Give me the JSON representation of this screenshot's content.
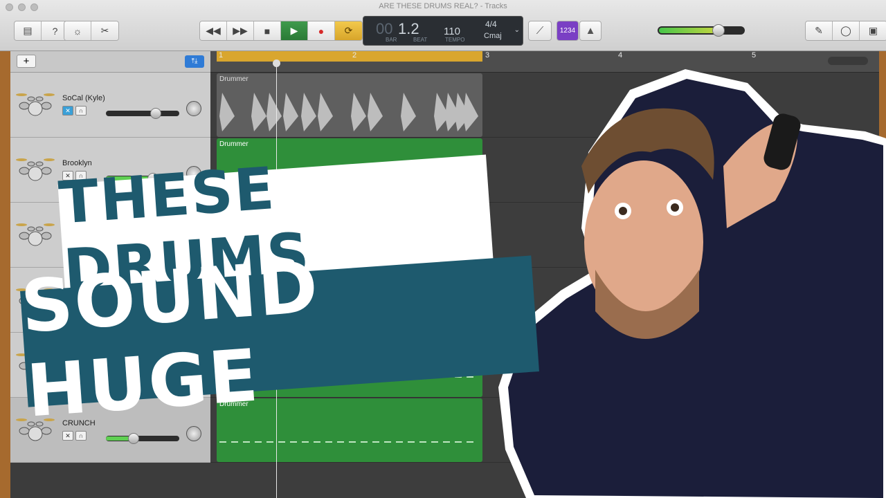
{
  "window": {
    "title": "ARE THESE DRUMS REAL? - Tracks"
  },
  "toolbar": {
    "left_icons": [
      "library-icon",
      "help-icon",
      "smart-controls-icon",
      "scissors-icon"
    ],
    "transport": [
      "rewind-icon",
      "forward-icon",
      "stop-icon",
      "play-icon",
      "record-icon",
      "cycle-icon"
    ],
    "lcd": {
      "bar_prefix": "00",
      "position": "1.2",
      "bar_label": "BAR",
      "beat_label": "BEAT",
      "tempo": "110",
      "tempo_label": "TEMPO",
      "signature": "4/4",
      "key": "Cmaj"
    },
    "count_in": "1234",
    "right_icons": [
      "notepad-icon",
      "loops-icon",
      "media-browser-icon"
    ],
    "master_volume": 0.72
  },
  "tracks_header": {
    "add_label": "+",
    "filter_label": "⤒⤓"
  },
  "ruler": {
    "bars": [
      "1",
      "2",
      "3",
      "4",
      "5"
    ]
  },
  "tracks": [
    {
      "name": "SoCal (Kyle)",
      "volume": 0.68,
      "region_label": "Drummer",
      "region_color": "#5f5f5f"
    },
    {
      "name": "Brooklyn",
      "volume": 0.64,
      "region_label": "Drummer",
      "region_color": "#2f8f3a"
    },
    {
      "name": "",
      "volume": 0.6,
      "region_label": "",
      "region_color": "#2f8f3a"
    },
    {
      "name": "",
      "volume": 0.6,
      "region_label": "",
      "region_color": "#2f8f3a"
    },
    {
      "name": "",
      "volume": 0.6,
      "region_label": "",
      "region_color": "#2f8f3a"
    },
    {
      "name": "CRUNCH",
      "volume": 0.38,
      "region_label": "Drummer",
      "region_color": "#2f8f3a"
    }
  ],
  "overlay": {
    "line1": "THESE DRUMS",
    "line2": "SOUND HUGE",
    "text_color": "#1e5a6e",
    "box_color": "#1e5a6e"
  }
}
